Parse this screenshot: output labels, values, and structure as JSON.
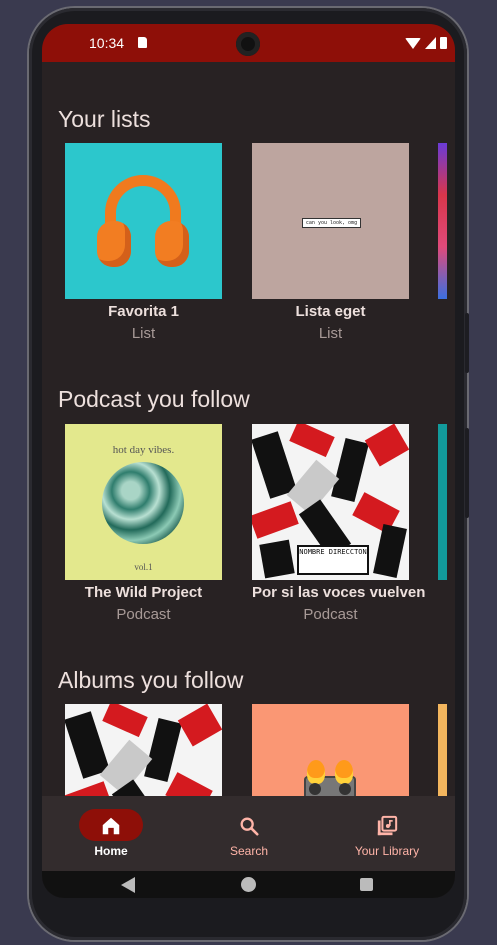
{
  "status_bar": {
    "time": "10:34"
  },
  "sections": [
    {
      "title": "Your lists",
      "items": [
        {
          "title": "Favorita 1",
          "subtitle": "List"
        },
        {
          "title": "Lista eget",
          "subtitle": "List",
          "art_text": "can you look, omg"
        }
      ]
    },
    {
      "title": "Podcast you follow",
      "items": [
        {
          "title": "The Wild Project",
          "subtitle": "Podcast",
          "art_text": "hot day vibes.",
          "art_subtext": "vol.1"
        },
        {
          "title": "Por si las voces vuelven",
          "subtitle": "Podcast",
          "art_text": "NOMBRE DIRECCTON"
        }
      ]
    },
    {
      "title": "Albums you follow",
      "items": [
        {
          "title": "",
          "subtitle": ""
        },
        {
          "title": "",
          "subtitle": ""
        }
      ]
    }
  ],
  "bottom_nav": {
    "items": [
      {
        "label": "Home",
        "icon": "home-icon",
        "active": true
      },
      {
        "label": "Search",
        "icon": "search-icon",
        "active": false
      },
      {
        "label": "Your Library",
        "icon": "library-icon",
        "active": false
      }
    ]
  },
  "colors": {
    "accent": "#8e0f08",
    "background": "#282223",
    "nav_label": "#ffb4a8"
  }
}
